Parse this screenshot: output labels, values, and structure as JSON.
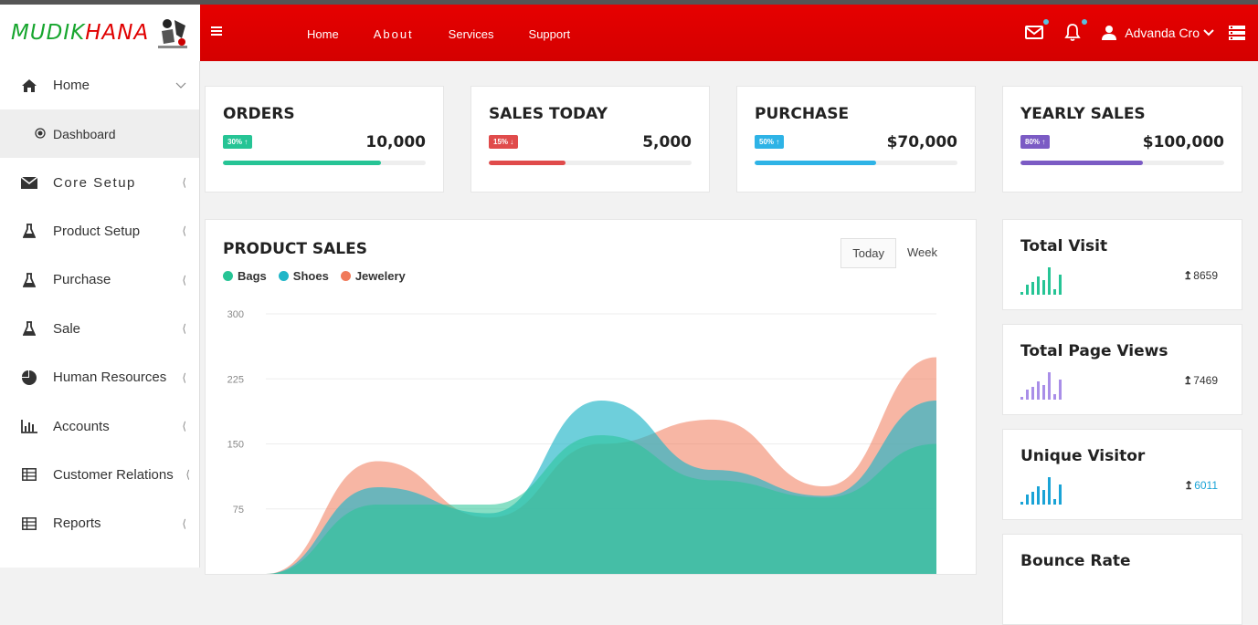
{
  "brand": {
    "name_green": "MUDIK",
    "name_red": "HANA"
  },
  "navbar": {
    "links": [
      "Home",
      "About",
      "Services",
      "Support"
    ],
    "user_name": "Advanda Cro"
  },
  "sidebar": {
    "items": [
      {
        "label": "Home",
        "icon": "home-icon"
      },
      {
        "label": "Dashboard",
        "icon": "radio-icon"
      },
      {
        "label": "Core Setup",
        "icon": "envelope-icon"
      },
      {
        "label": "Product Setup",
        "icon": "flask-icon"
      },
      {
        "label": "Purchase",
        "icon": "flask-icon"
      },
      {
        "label": "Sale",
        "icon": "flask-icon"
      },
      {
        "label": "Human Resources",
        "icon": "pie-chart-icon"
      },
      {
        "label": "Accounts",
        "icon": "bar-chart-icon"
      },
      {
        "label": "Customer Relations",
        "icon": "table-icon"
      },
      {
        "label": "Reports",
        "icon": "table-icon"
      }
    ]
  },
  "stats": [
    {
      "title": "ORDERS",
      "badge": "30% ↑",
      "value": "10,000",
      "progress": 0.78,
      "color": "#26c495"
    },
    {
      "title": "SALES TODAY",
      "badge": "15% ↓",
      "value": "5,000",
      "progress": 0.38,
      "color": "#e04b4b"
    },
    {
      "title": "PURCHASE",
      "badge": "50% ↑",
      "value": "$70,000",
      "progress": 0.6,
      "color": "#2eb3e6"
    },
    {
      "title": "YEARLY SALES",
      "badge": "80% ↑",
      "value": "$100,000",
      "progress": 0.6,
      "color": "#7b5bc4"
    }
  ],
  "product_sales": {
    "title": "PRODUCT SALES",
    "tabs": [
      "Today",
      "Week"
    ],
    "legend": [
      {
        "name": "Bags",
        "color": "#26c495"
      },
      {
        "name": "Shoes",
        "color": "#20b6c8"
      },
      {
        "name": "Jewelery",
        "color": "#f07a5a"
      }
    ]
  },
  "chart_data": {
    "type": "area",
    "y_ticks": [
      "300",
      "225",
      "150",
      "75"
    ],
    "ylim": [
      0,
      300
    ],
    "x": [
      0,
      1,
      2,
      3,
      4,
      5,
      6
    ],
    "series": [
      {
        "name": "Jewelery",
        "color": "#f07a5a",
        "values": [
          0,
          130,
          65,
          150,
          178,
          101,
          250
        ]
      },
      {
        "name": "Shoes",
        "color": "#20b6c8",
        "values": [
          0,
          100,
          70,
          200,
          120,
          90,
          200
        ]
      },
      {
        "name": "Bags",
        "color": "#26c495",
        "values": [
          0,
          80,
          80,
          160,
          108,
          88,
          150
        ]
      }
    ]
  },
  "mini_stats": [
    {
      "title": "Total Visit",
      "value": "8659",
      "color": "#26c495",
      "value_color": "#333"
    },
    {
      "title": "Total Page Views",
      "value": "7469",
      "color": "#a98ee8",
      "value_color": "#333"
    },
    {
      "title": "Unique Visitor",
      "value": "6011",
      "color": "#1aa3d6",
      "value_color": "#1aa3d6"
    },
    {
      "title": "Bounce Rate",
      "value": "",
      "color": "#26c495",
      "value_color": "#333"
    }
  ]
}
